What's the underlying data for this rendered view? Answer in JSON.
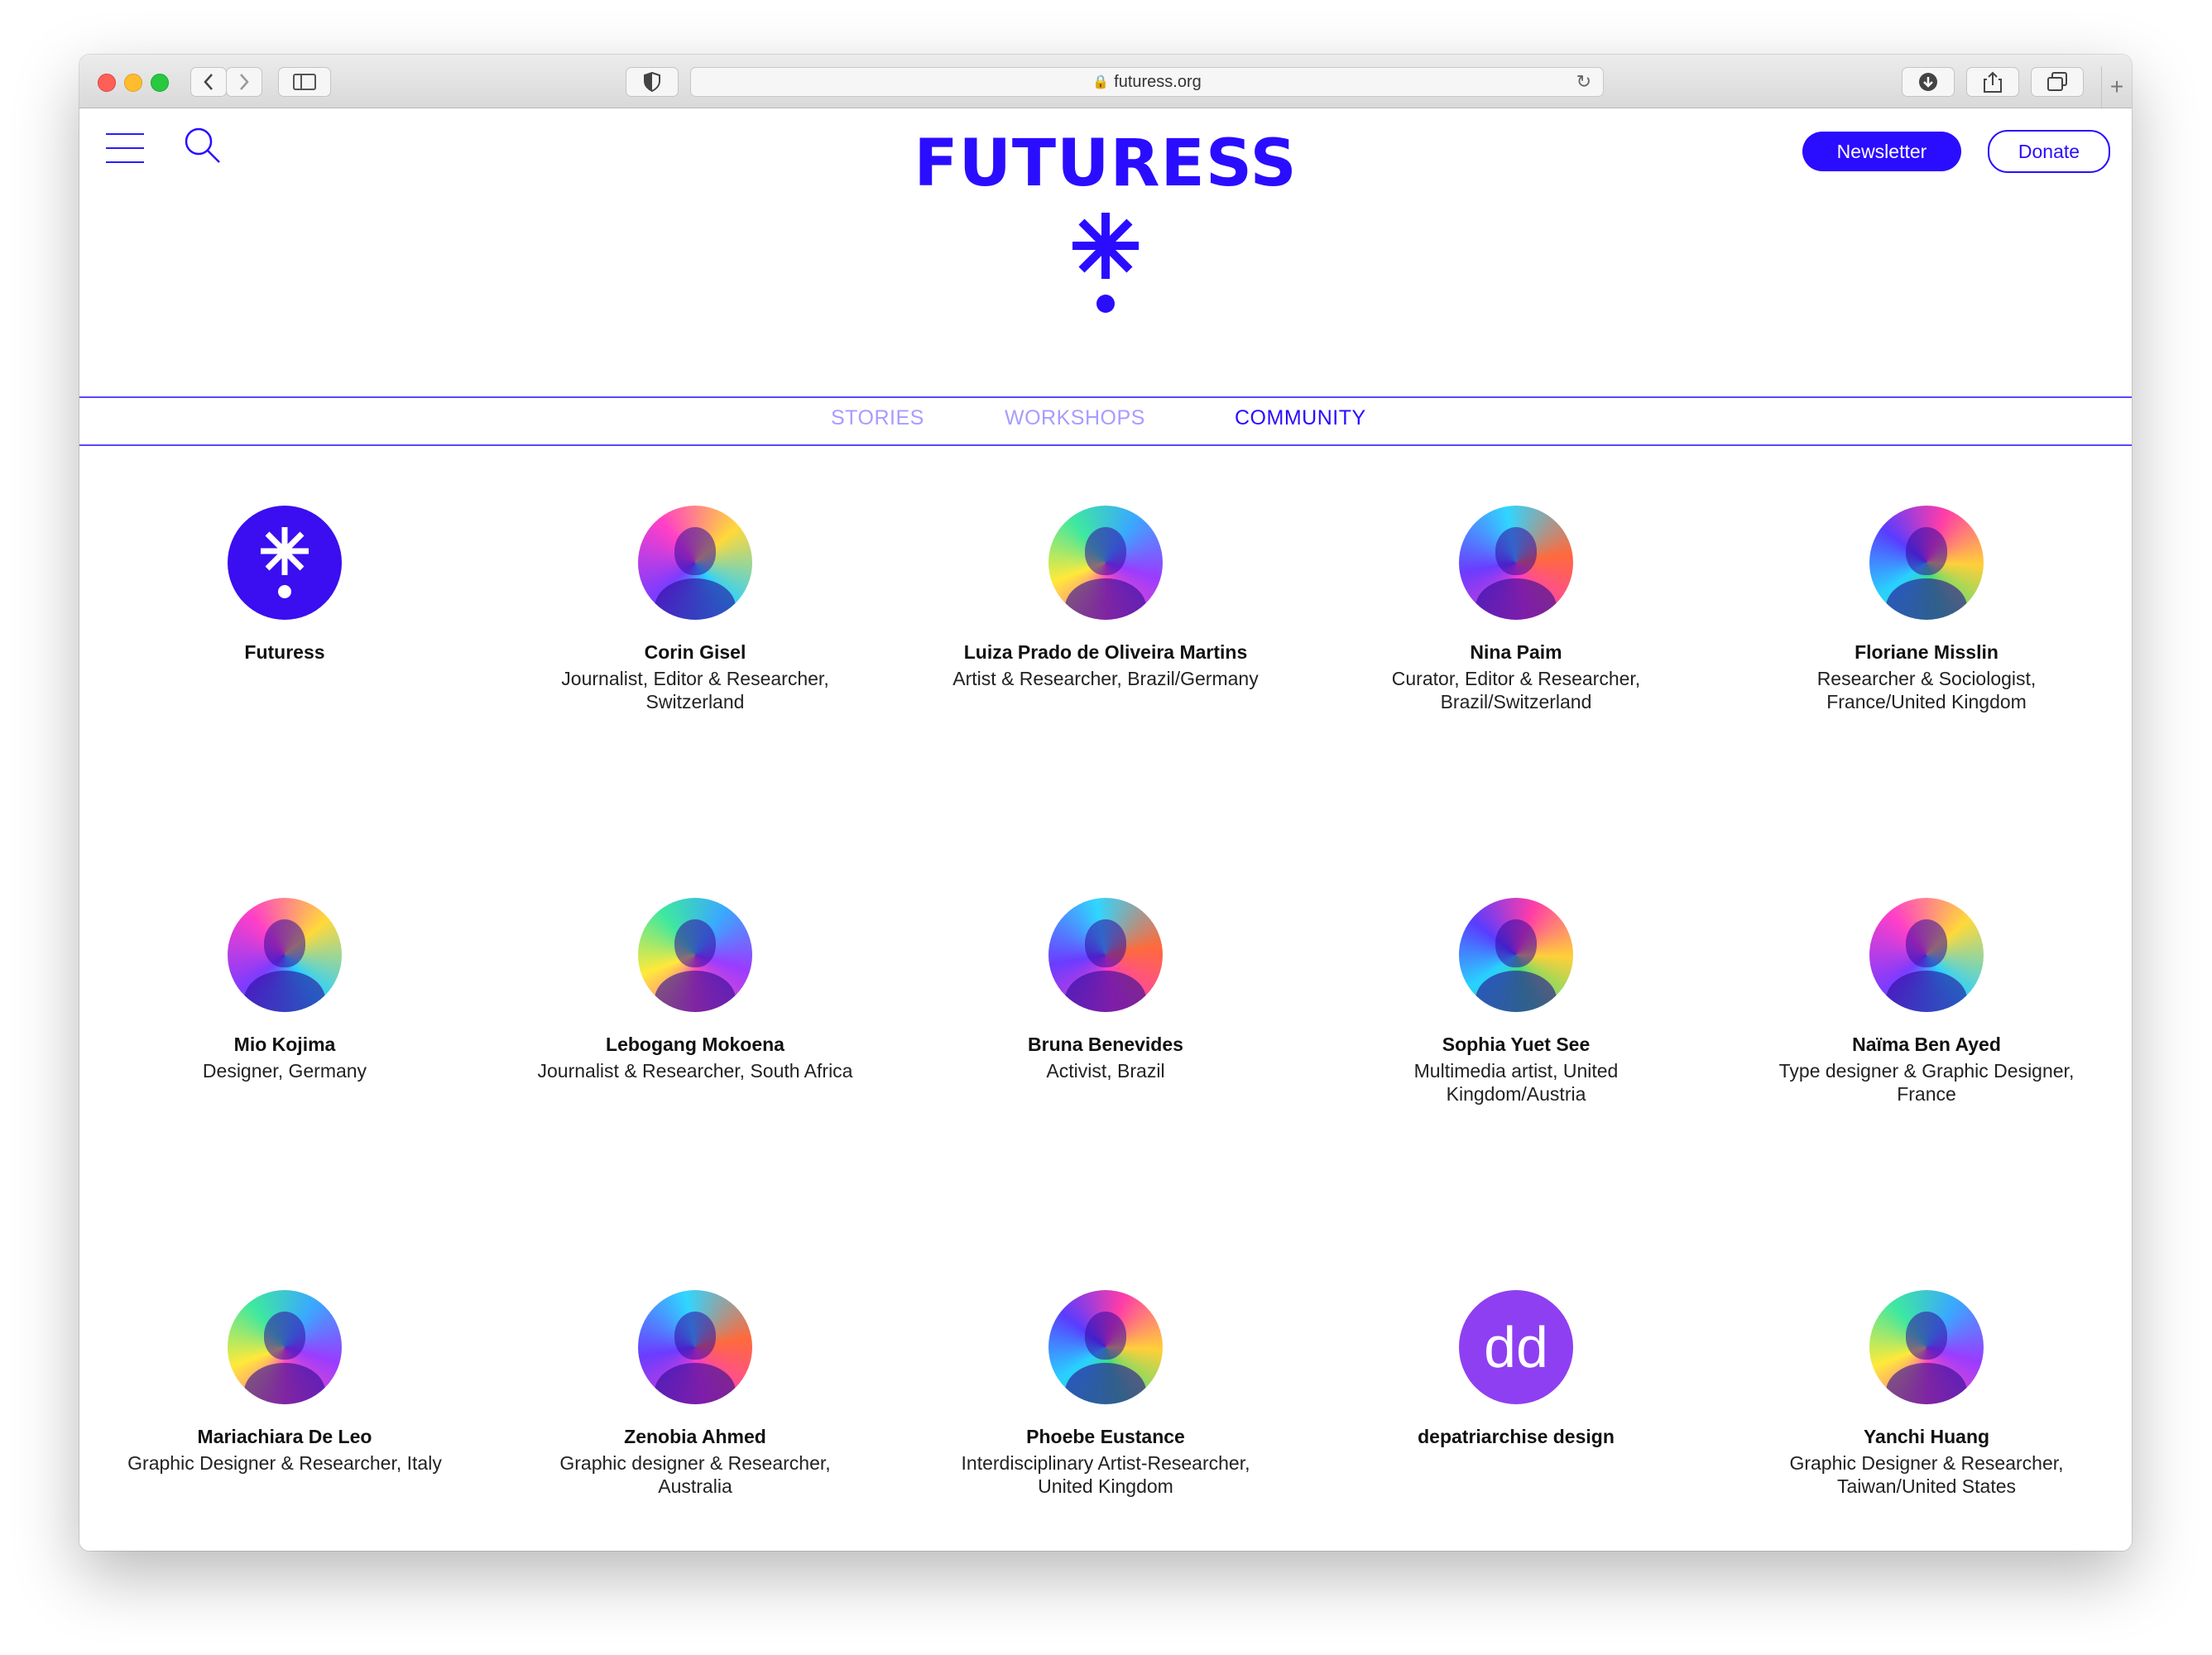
{
  "browser": {
    "url": "futuress.org"
  },
  "header": {
    "logo_text": "FUTURESS",
    "newsletter_label": "Newsletter",
    "donate_label": "Donate"
  },
  "nav": {
    "tabs": [
      {
        "label": "STORIES"
      },
      {
        "label": "WORKSHOPS"
      },
      {
        "label": "COMMUNITY"
      }
    ],
    "active": "COMMUNITY"
  },
  "community": [
    {
      "name": "Futuress",
      "role": "",
      "avatar": "futuress-logo"
    },
    {
      "name": "Corin Gisel",
      "role": "Journalist, Editor & Researcher, Switzerland",
      "avatar": "photo"
    },
    {
      "name": "Luiza Prado de Oliveira Martins",
      "role": "Artist & Researcher, Brazil/Germany",
      "avatar": "photo"
    },
    {
      "name": "Nina Paim",
      "role": "Curator, Editor & Researcher, Brazil/Switzerland",
      "avatar": "photo"
    },
    {
      "name": "Floriane Misslin",
      "role": "Researcher & Sociologist, France/United Kingdom",
      "avatar": "photo"
    },
    {
      "name": "Mio Kojima",
      "role": "Designer, Germany",
      "avatar": "photo"
    },
    {
      "name": "Lebogang Mokoena",
      "role": "Journalist & Researcher, South Africa",
      "avatar": "photo"
    },
    {
      "name": "Bruna Benevides",
      "role": "Activist, Brazil",
      "avatar": "photo"
    },
    {
      "name": "Sophia Yuet See",
      "role": "Multimedia artist, United Kingdom/Austria",
      "avatar": "photo"
    },
    {
      "name": "Naïma Ben Ayed",
      "role": "Type designer & Graphic Designer, France",
      "avatar": "photo"
    },
    {
      "name": "Mariachiara De Leo",
      "role": "Graphic Designer & Researcher, Italy",
      "avatar": "photo"
    },
    {
      "name": "Zenobia Ahmed",
      "role": "Graphic designer & Researcher, Australia",
      "avatar": "photo"
    },
    {
      "name": "Phoebe Eustance",
      "role": "Interdisciplinary Artist-Researcher, United Kingdom",
      "avatar": "photo"
    },
    {
      "name": "depatriarchise design",
      "role": "",
      "avatar": "initials",
      "initials": "dd"
    },
    {
      "name": "Yanchi Huang",
      "role": "Graphic Designer & Researcher, Taiwan/United States",
      "avatar": "photo"
    }
  ],
  "colors": {
    "brand": "#2a0dff",
    "nav_inactive": "#a79cff",
    "initials_bg": "#8f3ff2"
  }
}
